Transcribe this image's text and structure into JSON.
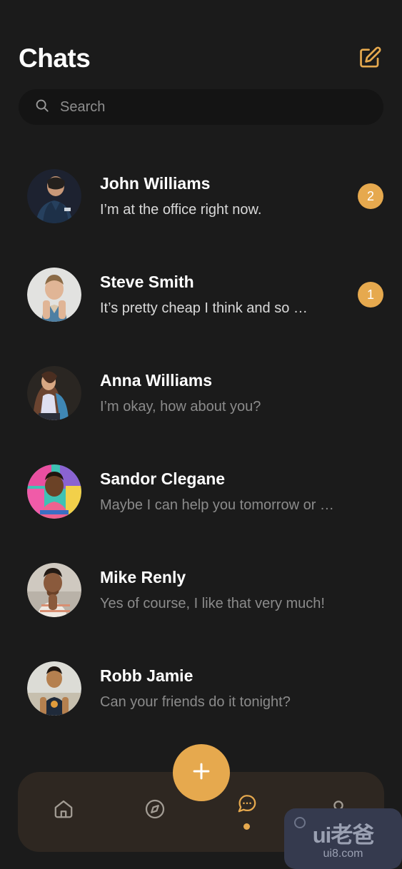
{
  "header": {
    "title": "Chats",
    "compose_icon": "compose-edit-icon"
  },
  "search": {
    "placeholder": "Search",
    "value": "",
    "icon": "search-icon"
  },
  "colors": {
    "background": "#1b1b1b",
    "accent": "#e6a94e",
    "nav_background": "#2e2721",
    "search_background": "#141414",
    "name_text": "#ffffff",
    "preview_unread": "#d9d9d9",
    "preview_read": "#8b8b8b"
  },
  "chats": [
    {
      "name": "John Williams",
      "preview": "I’m at the office right now.",
      "unread": "2",
      "has_unread": true,
      "avatar": "avatar-john-williams"
    },
    {
      "name": "Steve Smith",
      "preview": "It’s pretty cheap I think and so …",
      "unread": "1",
      "has_unread": true,
      "avatar": "avatar-steve-smith"
    },
    {
      "name": "Anna Williams",
      "preview": "I’m okay, how about you?",
      "unread": "",
      "has_unread": false,
      "avatar": "avatar-anna-williams"
    },
    {
      "name": "Sandor Clegane",
      "preview": "Maybe I can help you tomorrow or …",
      "unread": "",
      "has_unread": false,
      "avatar": "avatar-sandor-clegane"
    },
    {
      "name": "Mike Renly",
      "preview": "Yes of course, I like that very much!",
      "unread": "",
      "has_unread": false,
      "avatar": "avatar-mike-renly"
    },
    {
      "name": "Robb Jamie",
      "preview": "Can your friends do it tonight?",
      "unread": "",
      "has_unread": false,
      "avatar": "avatar-robb-jamie"
    }
  ],
  "fab": {
    "icon": "plus-icon",
    "label": "+"
  },
  "bottom_nav": [
    {
      "icon": "home-icon",
      "name": "home",
      "active": false
    },
    {
      "icon": "compass-icon",
      "name": "discover",
      "active": false
    },
    {
      "icon": "chat-bubble-icon",
      "name": "chats",
      "active": true
    },
    {
      "icon": "profile-icon",
      "name": "profile",
      "active": false
    }
  ],
  "watermark": {
    "logo": "ui老爸",
    "url": "ui8.com"
  }
}
